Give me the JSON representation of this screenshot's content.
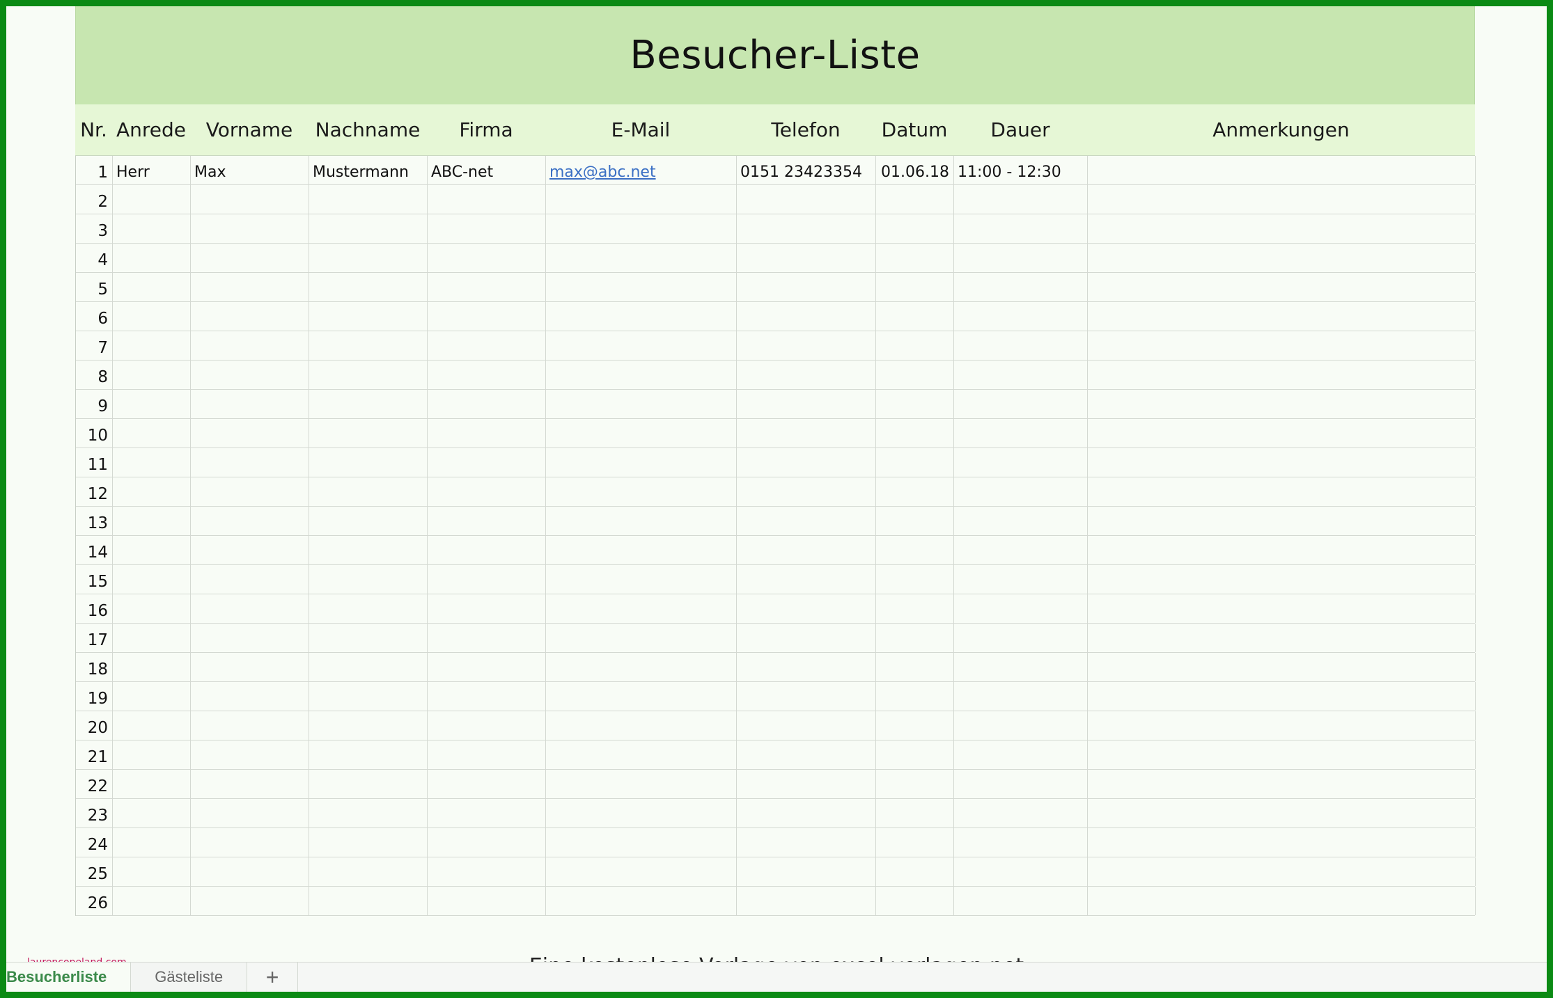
{
  "sheet": {
    "title": "Besucher-Liste",
    "columns": [
      "Nr.",
      "Anrede",
      "Vorname",
      "Nachname",
      "Firma",
      "E-Mail",
      "Telefon",
      "Datum",
      "Dauer",
      "Anmerkungen"
    ],
    "rows": [
      {
        "nr": "1",
        "anrede": "Herr",
        "vorname": "Max",
        "nachname": "Mustermann",
        "firma": "ABC-net",
        "email": "max@abc.net",
        "telefon": "0151 23423354",
        "datum": "01.06.18",
        "dauer": "11:00 - 12:30",
        "anmerkungen": ""
      },
      {
        "nr": "2"
      },
      {
        "nr": "3"
      },
      {
        "nr": "4"
      },
      {
        "nr": "5"
      },
      {
        "nr": "6"
      },
      {
        "nr": "7"
      },
      {
        "nr": "8"
      },
      {
        "nr": "9"
      },
      {
        "nr": "10"
      },
      {
        "nr": "11"
      },
      {
        "nr": "12"
      },
      {
        "nr": "13"
      },
      {
        "nr": "14"
      },
      {
        "nr": "15"
      },
      {
        "nr": "16"
      },
      {
        "nr": "17"
      },
      {
        "nr": "18"
      },
      {
        "nr": "19"
      },
      {
        "nr": "20"
      },
      {
        "nr": "21"
      },
      {
        "nr": "22"
      },
      {
        "nr": "23"
      },
      {
        "nr": "24"
      },
      {
        "nr": "25"
      },
      {
        "nr": "26"
      }
    ],
    "footer_text": "Eine kostenlose Vorlage von excel-vorlagen.net"
  },
  "watermark": "laurencopeland.com",
  "tabs": {
    "items": [
      "Besucherliste",
      "Gästeliste"
    ],
    "active": 0,
    "add_glyph": "+"
  },
  "colors": {
    "frame": "#0b8a14",
    "title_band": "#c7e6b0",
    "header_band": "#e6f7d6",
    "link": "#3a6fc4",
    "active_tab": "#3b8a4a"
  }
}
